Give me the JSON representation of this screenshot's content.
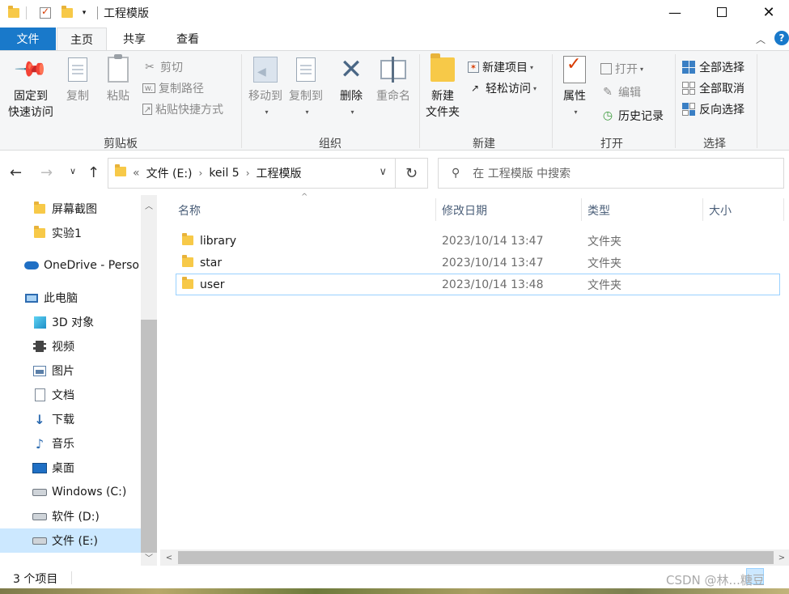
{
  "window": {
    "title": "工程模版"
  },
  "colors": {
    "accent": "#1979ca",
    "selection": "#cce8ff",
    "folder": "#f7c948"
  },
  "tabs": [
    "文件",
    "主页",
    "共享",
    "查看"
  ],
  "ribbon": {
    "clipboard": {
      "label": "剪贴板",
      "pin_line1": "固定到",
      "pin_line2": "快速访问",
      "copy": "复制",
      "paste": "粘贴",
      "cut": "剪切",
      "copy_path": "复制路径",
      "paste_shortcut": "粘贴快捷方式"
    },
    "organize": {
      "label": "组织",
      "move_to": "移动到",
      "copy_to": "复制到",
      "delete": "删除",
      "rename": "重命名"
    },
    "new": {
      "label": "新建",
      "new_folder_line1": "新建",
      "new_folder_line2": "文件夹",
      "new_item": "新建项目",
      "easy_access": "轻松访问"
    },
    "open": {
      "label": "打开",
      "properties": "属性",
      "open": "打开",
      "edit": "编辑",
      "history": "历史记录"
    },
    "select": {
      "label": "选择",
      "select_all": "全部选择",
      "select_none": "全部取消",
      "invert": "反向选择"
    }
  },
  "address": {
    "overflow": "«",
    "crumbs": [
      "文件 (E:)",
      "keil 5",
      "工程模版"
    ],
    "search_placeholder": "在 工程模版 中搜索"
  },
  "sidebar": {
    "items": [
      {
        "label": "屏幕截图",
        "icon": "folder-icon"
      },
      {
        "label": "实验1",
        "icon": "folder-icon"
      },
      {
        "label": "OneDrive - Perso",
        "icon": "cloud-icon"
      },
      {
        "label": "此电脑",
        "icon": "computer-icon"
      },
      {
        "label": "3D 对象",
        "icon": "cube-icon"
      },
      {
        "label": "视频",
        "icon": "film-icon"
      },
      {
        "label": "图片",
        "icon": "picture-icon"
      },
      {
        "label": "文档",
        "icon": "document-icon"
      },
      {
        "label": "下载",
        "icon": "download-icon"
      },
      {
        "label": "音乐",
        "icon": "music-icon"
      },
      {
        "label": "桌面",
        "icon": "desktop-icon"
      },
      {
        "label": "Windows (C:)",
        "icon": "drive-icon"
      },
      {
        "label": "软件 (D:)",
        "icon": "drive-icon"
      },
      {
        "label": "文件 (E:)",
        "icon": "drive-icon"
      }
    ]
  },
  "columns": [
    "名称",
    "修改日期",
    "类型",
    "大小"
  ],
  "files": [
    {
      "name": "library",
      "date": "2023/10/14 13:47",
      "type": "文件夹",
      "size": ""
    },
    {
      "name": "star",
      "date": "2023/10/14 13:47",
      "type": "文件夹",
      "size": ""
    },
    {
      "name": "user",
      "date": "2023/10/14 13:48",
      "type": "文件夹",
      "size": ""
    }
  ],
  "status": {
    "count": "3 个项目"
  },
  "watermark": "CSDN @林...糖豆"
}
